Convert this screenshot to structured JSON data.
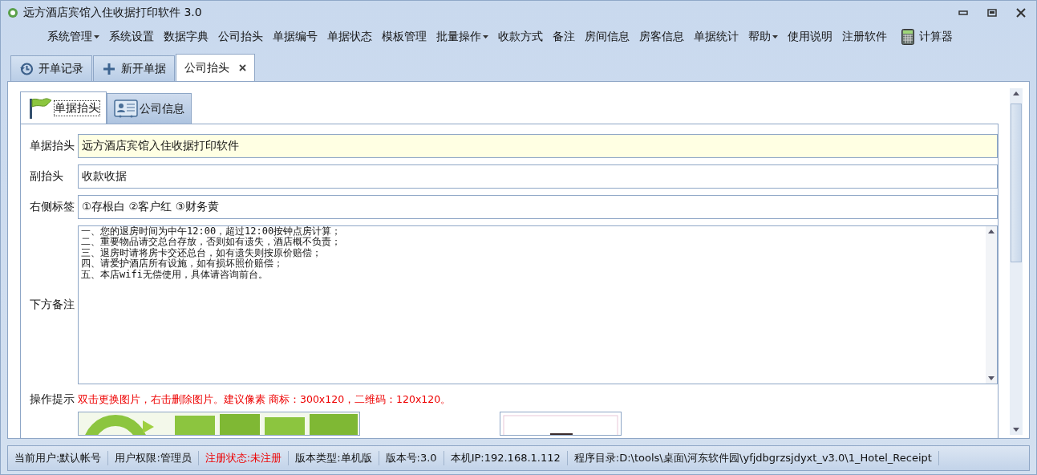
{
  "window": {
    "title": "远方酒店宾馆入住收据打印软件 3.0"
  },
  "menu": [
    {
      "label": "系统管理",
      "dropdown": true
    },
    {
      "label": "系统设置",
      "dropdown": false
    },
    {
      "label": "数据字典",
      "dropdown": false
    },
    {
      "label": "公司抬头",
      "dropdown": false
    },
    {
      "label": "单据编号",
      "dropdown": false
    },
    {
      "label": "单据状态",
      "dropdown": false
    },
    {
      "label": "模板管理",
      "dropdown": false
    },
    {
      "label": "批量操作",
      "dropdown": true
    },
    {
      "label": "收款方式",
      "dropdown": false
    },
    {
      "label": "备注",
      "dropdown": false
    },
    {
      "label": "房间信息",
      "dropdown": false
    },
    {
      "label": "房客信息",
      "dropdown": false
    },
    {
      "label": "单据统计",
      "dropdown": false
    },
    {
      "label": "帮助",
      "dropdown": true
    },
    {
      "label": "使用说明",
      "dropdown": false
    },
    {
      "label": "注册软件",
      "dropdown": false
    }
  ],
  "calculator": {
    "label": "计算器"
  },
  "tabs": [
    {
      "label": "开单记录",
      "kind": "history",
      "selected": false,
      "closable": false
    },
    {
      "label": "新开单据",
      "kind": "plus",
      "selected": false,
      "closable": false
    },
    {
      "label": "公司抬头",
      "kind": "plain",
      "selected": true,
      "closable": true
    }
  ],
  "sub_tabs": [
    {
      "label": "单据抬头",
      "kind": "flag",
      "selected": true
    },
    {
      "label": "公司信息",
      "kind": "card",
      "selected": false
    }
  ],
  "fields": [
    {
      "label": "单据抬头",
      "value": "远方酒店宾馆入住收据打印软件",
      "highlighted": true
    },
    {
      "label": "副抬头",
      "value": "收款收据",
      "highlighted": false
    },
    {
      "label": "右侧标签",
      "value": "①存根白 ②客户红 ③财务黄",
      "highlighted": false
    }
  ],
  "remarks": {
    "label": "下方备注",
    "lines": [
      "一、您的退房时间为中午12:00，超过12:00按钟点房计算；",
      "二、重要物品请交总台存放，否则如有遗失，酒店概不负责；",
      "三、退房时请将房卡交还总台，如有遗失则按原价赔偿；",
      "四、请爱护酒店所有设施，如有损坏照价赔偿；",
      "五、本店wifi无偿使用，具体请咨询前台。"
    ]
  },
  "hint": {
    "label": "操作提示",
    "text": "双击更换图片，右击删除图片。建议像素 商标：300x120，二维码：120x120。"
  },
  "status_bar": [
    {
      "text": "当前用户:默认帐号",
      "alert": false
    },
    {
      "text": "用户权限:管理员",
      "alert": false
    },
    {
      "text": "注册状态:未注册",
      "alert": true
    },
    {
      "text": "版本类型:单机版",
      "alert": false
    },
    {
      "text": "版本号:3.0",
      "alert": false
    },
    {
      "text": "本机IP:192.168.1.112",
      "alert": false
    },
    {
      "text": "程序目录:D:\\tools\\桌面\\河东软件园\\yfjdbgrzsjdyxt_v3.0\\1_Hotel_Receipt",
      "alert": false
    }
  ]
}
